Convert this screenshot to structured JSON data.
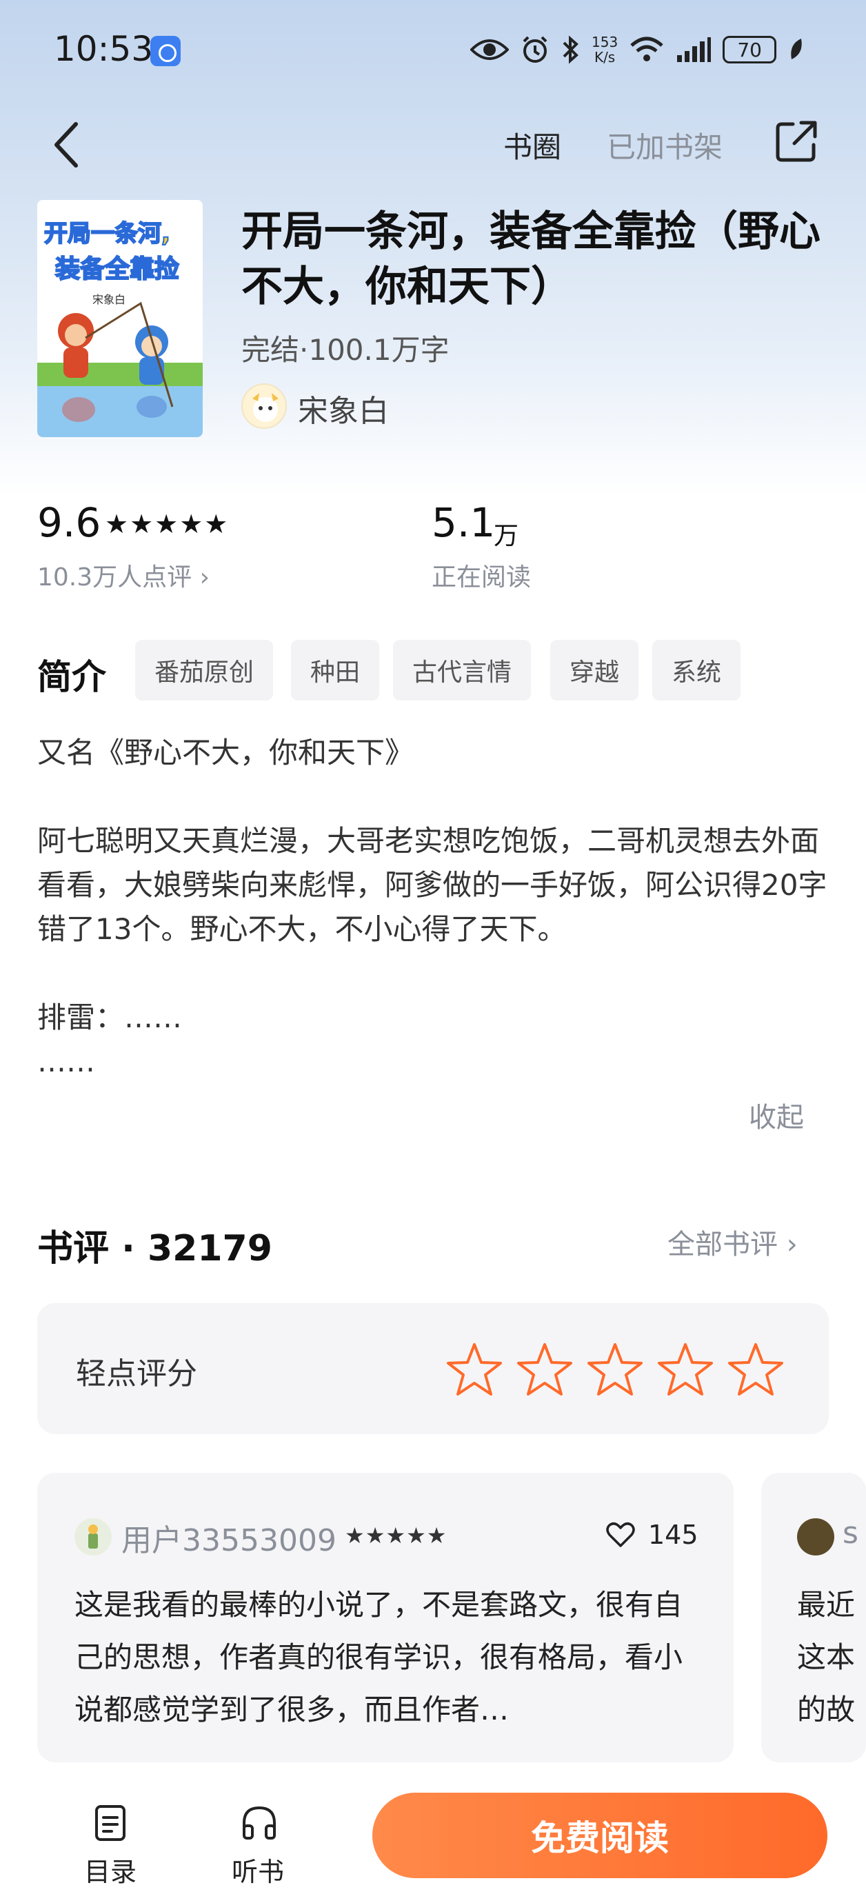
{
  "status_bar": {
    "time": "10:53",
    "net_speed_value": "153",
    "net_speed_unit": "K/s",
    "battery": "70"
  },
  "nav": {
    "circle_label": "书圈",
    "shelf_label": "已加书架"
  },
  "book": {
    "title": "开局一条河，装备全靠捡（野心不大，你和天下）",
    "meta": "完结·100.1万字",
    "author": "宋象白",
    "cover_title_line1": "开局一条河,",
    "cover_title_line2": "装备全靠捡",
    "cover_author": "宋象白"
  },
  "stats": {
    "score": "9.6",
    "stars": "★★★★★",
    "rating_count": "10.3万人点评 ›",
    "reading_value": "5.1",
    "reading_unit": "万",
    "reading_label": "正在阅读"
  },
  "intro": {
    "heading": "简介",
    "tags": [
      "番茄原创",
      "种田",
      "古代言情",
      "穿越",
      "系统"
    ],
    "paragraphs": [
      "又名《野心不大，你和天下》",
      "阿七聪明又天真烂漫，大哥老实想吃饱饭，二哥机灵想去外面看看，大娘劈柴向来彪悍，阿爹做的一手好饭，阿公识得20字错了13个。野心不大，不小心得了天下。",
      "排雷：……\n……"
    ],
    "collapse_label": "收起"
  },
  "reviews": {
    "heading": "书评 · 32179",
    "all_label": "全部书评 ›",
    "quick_rate_label": "轻点评分",
    "quick_rate_star_count": 5,
    "accent_color": "#ff6a2a",
    "items": [
      {
        "user": "用户33553009",
        "stars": "★★★★★",
        "likes": "145",
        "body": "这是我看的最棒的小说了，不是套路文，很有自己的思想，作者真的很有学识，很有格局，看小说都感觉学到了很多，而且作者…"
      },
      {
        "user": "s",
        "body": "最近\n这本\n的故"
      }
    ]
  },
  "bottom_bar": {
    "toc_label": "目录",
    "listen_label": "听书",
    "read_label": "免费阅读"
  }
}
